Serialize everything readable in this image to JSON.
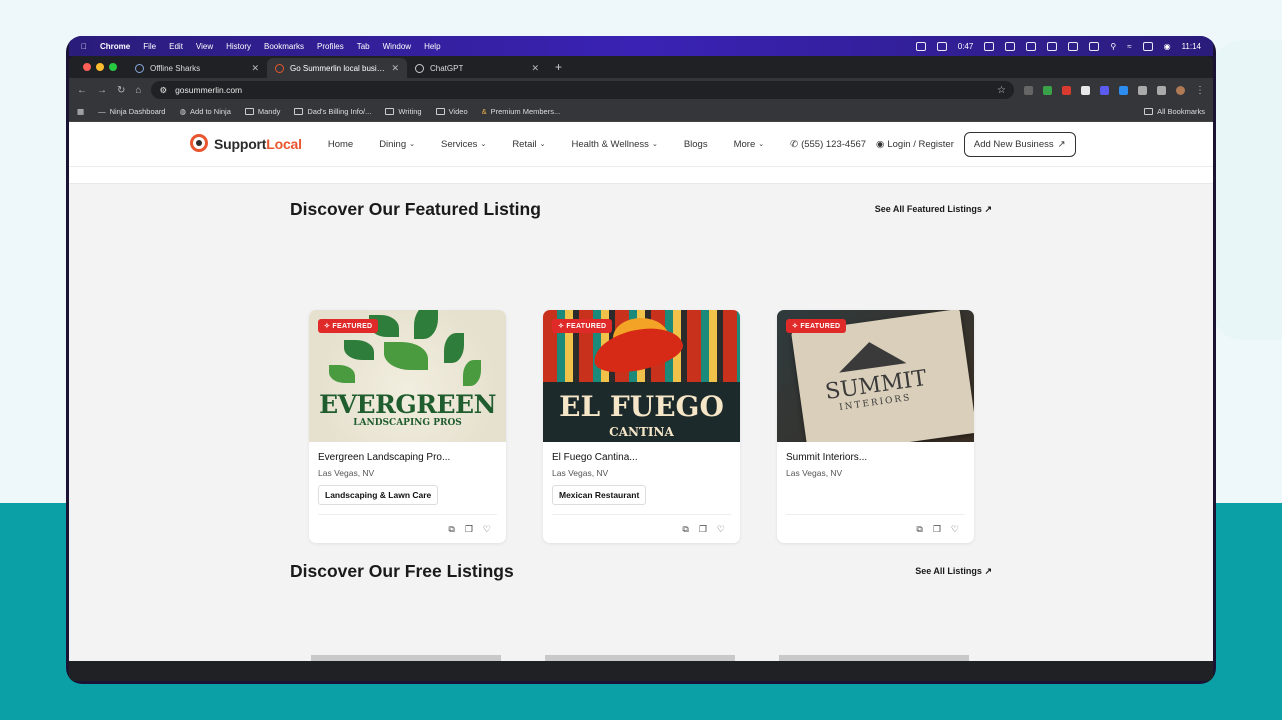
{
  "menubar": {
    "items": [
      "Chrome",
      "File",
      "Edit",
      "View",
      "History",
      "Bookmarks",
      "Profiles",
      "Tab",
      "Window",
      "Help"
    ],
    "timer": "0:47",
    "clock": "11:14"
  },
  "tabs": [
    {
      "title": "Offline Sharks"
    },
    {
      "title": "Go Summerlin local businesses",
      "active": true
    },
    {
      "title": "ChatGPT"
    }
  ],
  "omnibox": {
    "url": "gosummerlin.com"
  },
  "bookmarks": {
    "items": [
      "Ninja Dashboard",
      "Add to Ninja",
      "Mandy",
      "Dad's Billing Info/...",
      "Writing",
      "Video",
      "Premium Members..."
    ],
    "all": "All Bookmarks"
  },
  "site": {
    "logo_part1": "Support",
    "logo_part2": "Local",
    "nav": [
      "Home",
      "Dining",
      "Services",
      "Retail",
      "Health & Wellness",
      "Blogs",
      "More"
    ],
    "phone": "(555) 123-4567",
    "login": "Login / Register",
    "add_business": "Add New Business"
  },
  "featured": {
    "title": "Discover Our Featured Listing",
    "see_all": "See All Featured Listings",
    "badge": "FEATURED",
    "cards": [
      {
        "name": "Evergreen Landscaping Pro...",
        "location": "Las Vegas, NV",
        "tag": "Landscaping & Lawn Care",
        "img_word": "EVERGREEN",
        "img_sub": "LANDSCAPING PROS"
      },
      {
        "name": "El Fuego Cantina...",
        "location": "Las Vegas, NV",
        "tag": "Mexican Restaurant",
        "img_word": "EL FUEGO",
        "img_sub": "CANTINA"
      },
      {
        "name": "Summit Interiors...",
        "location": "Las Vegas, NV",
        "tag": "",
        "img_word": "SUMMIT",
        "img_sub": "INTERIORS"
      }
    ]
  },
  "free": {
    "title": "Discover Our Free Listings",
    "see_all": "See All Listings"
  },
  "colors": {
    "accent": "#e8552e",
    "badge": "#e02a2a",
    "teal_bg": "#0aa0a6"
  }
}
